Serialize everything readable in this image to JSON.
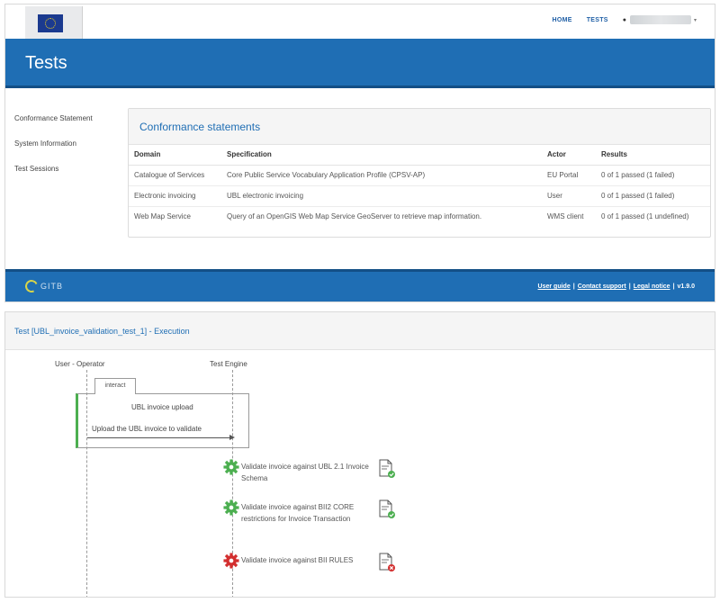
{
  "navbar": {
    "links": [
      "HOME",
      "TESTS"
    ]
  },
  "banner": {
    "title": "Tests"
  },
  "sidebar": {
    "items": [
      {
        "label": "Conformance Statement"
      },
      {
        "label": "System Information"
      },
      {
        "label": "Test Sessions"
      }
    ]
  },
  "conformance": {
    "title": "Conformance statements",
    "columns": [
      "Domain",
      "Specification",
      "Actor",
      "Results"
    ],
    "rows": [
      {
        "domain": "Catalogue of Services",
        "specification": "Core Public Service Vocabulary Application Profile (CPSV-AP)",
        "actor": "EU Portal",
        "results": "0 of 1 passed (1 failed)"
      },
      {
        "domain": "Electronic invoicing",
        "specification": "UBL electronic invoicing",
        "actor": "User",
        "results": "0 of 1 passed (1 failed)"
      },
      {
        "domain": "Web Map Service",
        "specification": "Query of an OpenGIS Web Map Service GeoServer to retrieve map information.",
        "actor": "WMS client",
        "results": "0 of 1 passed (1 undefined)"
      }
    ]
  },
  "footer": {
    "logo_text": "GITB",
    "links": [
      "User guide",
      "Contact support",
      "Legal notice"
    ],
    "version": "v1.9.0"
  },
  "execution": {
    "title": "Test [UBL_invoice_validation_test_1] - Execution",
    "actors": [
      "User - Operator",
      "Test Engine"
    ],
    "interact": {
      "tab_label": "interact",
      "title": "UBL invoice upload",
      "message": "Upload the UBL invoice to validate"
    },
    "steps": [
      {
        "text": "Validate invoice against UBL 2.1 Invoice Schema",
        "status": "success",
        "gear_color": "#4caf50",
        "badge_color": "#4caf50",
        "icon": "gear-icon"
      },
      {
        "text": "Validate invoice against BII2 CORE restrictions for Invoice Transaction",
        "status": "success",
        "gear_color": "#4caf50",
        "badge_color": "#4caf50",
        "icon": "gear-icon"
      },
      {
        "text": "Validate invoice against BII RULES",
        "status": "error",
        "gear_color": "#d32f2f",
        "badge_color": "#d32f2f",
        "icon": "gear-icon"
      }
    ]
  },
  "colors": {
    "brand_blue": "#1f6eb4",
    "success": "#4caf50",
    "error": "#d32f2f"
  }
}
